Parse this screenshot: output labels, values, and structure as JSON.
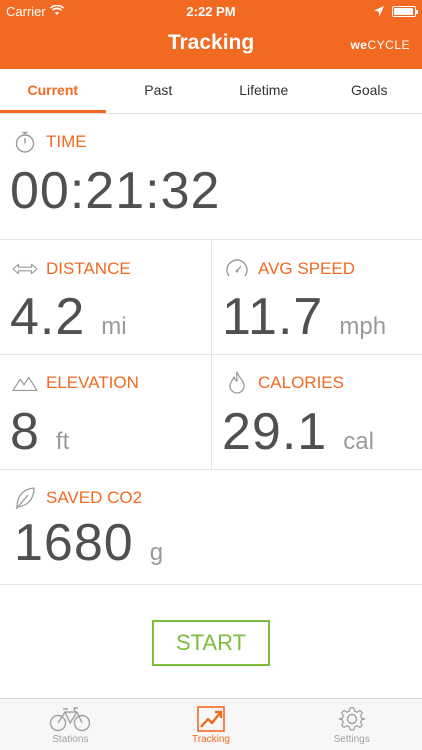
{
  "status_bar": {
    "carrier": "Carrier",
    "time": "2:22 PM",
    "battery_level": 0.95
  },
  "nav": {
    "title": "Tracking",
    "brand_we": "we",
    "brand_cycle": "CYCLE"
  },
  "tabs": [
    {
      "label": "Current",
      "active": true
    },
    {
      "label": "Past",
      "active": false
    },
    {
      "label": "Lifetime",
      "active": false
    },
    {
      "label": "Goals",
      "active": false
    }
  ],
  "metrics": {
    "time": {
      "label": "TIME",
      "value": "00:21:32",
      "icon": "stopwatch-icon"
    },
    "distance": {
      "label": "DISTANCE",
      "value": "4.2",
      "unit": "mi",
      "icon": "distance-arrows-icon"
    },
    "avg_speed": {
      "label": "AVG SPEED",
      "value": "11.7",
      "unit": "mph",
      "icon": "speedometer-icon"
    },
    "elevation": {
      "label": "ELEVATION",
      "value": "8",
      "unit": "ft",
      "icon": "mountain-icon"
    },
    "calories": {
      "label": "CALORIES",
      "value": "29.1",
      "unit": "cal",
      "icon": "flame-icon"
    },
    "saved_co2": {
      "label": "SAVED CO2",
      "value": "1680",
      "unit": "g",
      "icon": "leaf-icon"
    }
  },
  "start_label": "START",
  "tabbar": [
    {
      "label": "Stations",
      "icon": "bicycle-icon",
      "active": false
    },
    {
      "label": "Tracking",
      "icon": "chart-trend-icon",
      "active": true
    },
    {
      "label": "Settings",
      "icon": "gear-icon",
      "active": false
    }
  ],
  "colors": {
    "accent": "#f26a21",
    "start_green": "#7cbd3d",
    "value_text": "#505050",
    "unit_text": "#9a9a9a"
  }
}
